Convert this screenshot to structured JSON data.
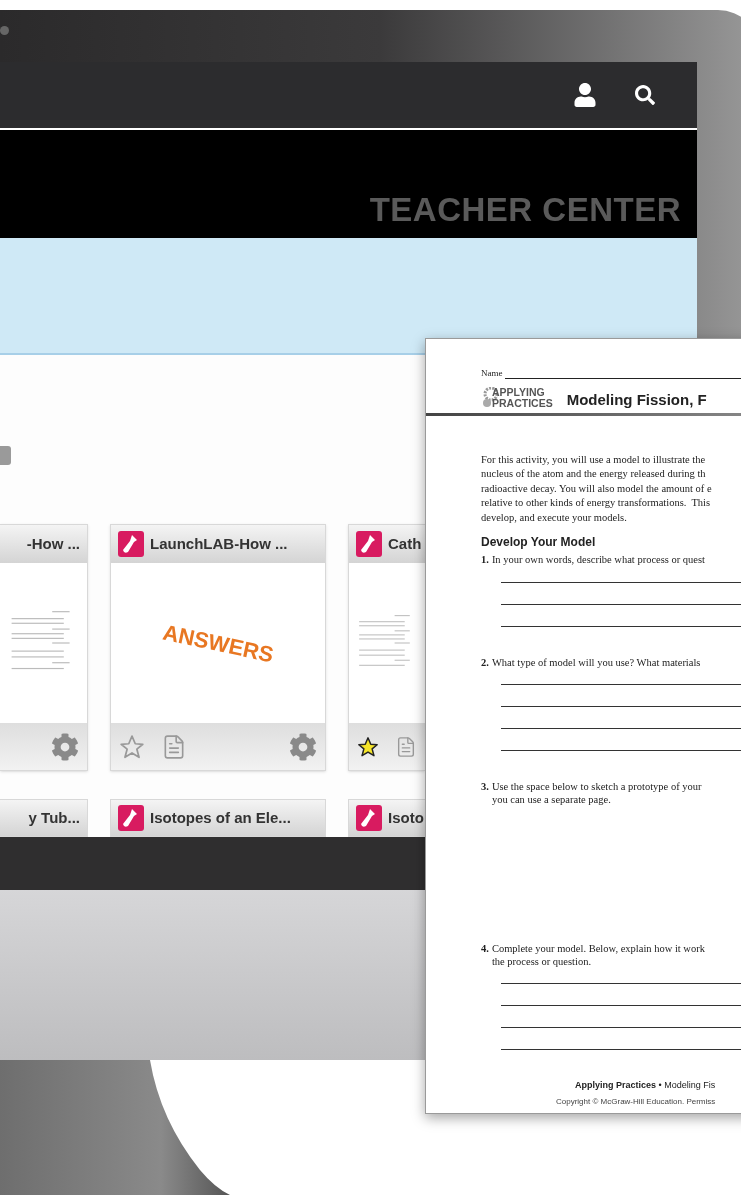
{
  "banner": {
    "title": "TEACHER CENTER"
  },
  "cards": [
    {
      "title": "-How ...",
      "kind": "document",
      "footer": [
        {
          "kind": "gear"
        }
      ]
    },
    {
      "title": "LaunchLAB-How ...",
      "kind": "answers",
      "preview_text": "ANSWERS",
      "starred": false,
      "footer": [
        {
          "kind": "star"
        },
        {
          "kind": "doc"
        },
        {
          "kind": "gear"
        }
      ]
    },
    {
      "title": "Cath",
      "kind": "document",
      "starred": true,
      "footer": [
        {
          "kind": "star"
        },
        {
          "kind": "doc"
        }
      ]
    }
  ],
  "cards_row_2": [
    {
      "title": "y Tub..."
    },
    {
      "title": "Isotopes of an Ele..."
    },
    {
      "title": "Isoto"
    }
  ],
  "worksheet": {
    "name_label": "Name",
    "logo": [
      "APPLYING",
      "PRACTICES"
    ],
    "title": "Modeling Fission, F",
    "intro": [
      "For this activity, you will use a model to illustrate the",
      "nucleus of the atom and the energy released during th",
      "radioactive decay. You will also model the amount of e",
      "relative to other kinds of energy transformations.  This",
      "develop, and execute your models."
    ],
    "section": "Develop Your Model",
    "questions": [
      {
        "number": "1.",
        "lines": [
          "In your own words, describe what process or quest"
        ],
        "kind": "short"
      },
      {
        "number": "2.",
        "lines": [
          "What type of model will you use? What materials"
        ],
        "kind": "long"
      },
      {
        "number": "3.",
        "lines": [
          "Use the space below to sketch a prototype of your",
          "you can use a separate page."
        ],
        "kind": "sketch"
      },
      {
        "number": "4.",
        "lines": [
          "Complete your model. Below, explain how it work",
          "the process or question."
        ],
        "kind": "long"
      }
    ],
    "footer": "**Applying Practices** • Modeling Fis",
    "copyright": "Copyright © McGraw-Hill Education. Permiss"
  }
}
